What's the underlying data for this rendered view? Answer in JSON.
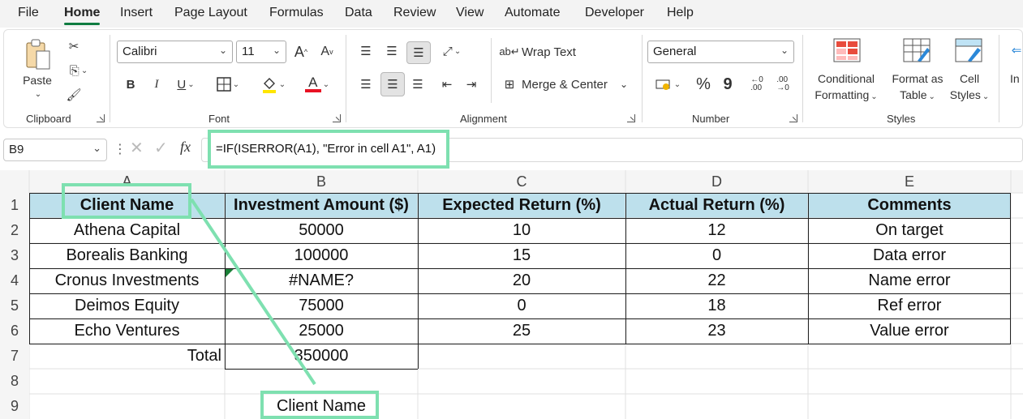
{
  "menu": {
    "tabs": [
      "File",
      "Home",
      "Insert",
      "Page Layout",
      "Formulas",
      "Data",
      "Review",
      "View",
      "Automate",
      "Developer",
      "Help"
    ],
    "active": "Home"
  },
  "ribbon": {
    "clipboard": {
      "paste": "Paste",
      "label": "Clipboard"
    },
    "font": {
      "name": "Calibri",
      "size": "11",
      "bold": "B",
      "italic": "I",
      "underline": "U",
      "grow": "A",
      "shrink": "A",
      "color_a": "A",
      "label": "Font"
    },
    "alignment": {
      "wrap_text": "Wrap Text",
      "merge_center": "Merge & Center",
      "label": "Alignment"
    },
    "number": {
      "format": "General",
      "percent": "%",
      "comma": "9",
      "label": "Number"
    },
    "styles": {
      "conditional": [
        "Conditional",
        "Formatting"
      ],
      "format_table": [
        "Format as",
        "Table"
      ],
      "cell_styles": [
        "Cell",
        "Styles"
      ],
      "insert_cut": "In",
      "label": "Styles"
    }
  },
  "formula_bar": {
    "name_box": "B9",
    "fx": "fx",
    "formula": "=IF(ISERROR(A1), \"Error in cell A1\", A1)"
  },
  "grid": {
    "columns": [
      "A",
      "B",
      "C",
      "D",
      "E"
    ],
    "rows": [
      "1",
      "2",
      "3",
      "4",
      "5",
      "6",
      "7",
      "8",
      "9"
    ],
    "header": [
      "Client Name",
      "Investment Amount ($)",
      "Expected Return (%)",
      "Actual Return (%)",
      "Comments"
    ],
    "data": [
      [
        "Athena Capital",
        "50000",
        "10",
        "12",
        "On target"
      ],
      [
        "Borealis Banking",
        "100000",
        "15",
        "0",
        "Data error"
      ],
      [
        "Cronus Investments",
        "#NAME?",
        "20",
        "22",
        "Name error"
      ],
      [
        "Deimos Equity",
        "75000",
        "0",
        "18",
        "Ref error"
      ],
      [
        "Echo Ventures",
        "25000",
        "25",
        "23",
        "Value error"
      ]
    ],
    "total_label": "Total",
    "total_value": "350000",
    "result_b9": "Client Name"
  },
  "colors": {
    "header_fill": "#bde0ec",
    "highlight": "#7ee0b0",
    "accent": "#107c41"
  }
}
